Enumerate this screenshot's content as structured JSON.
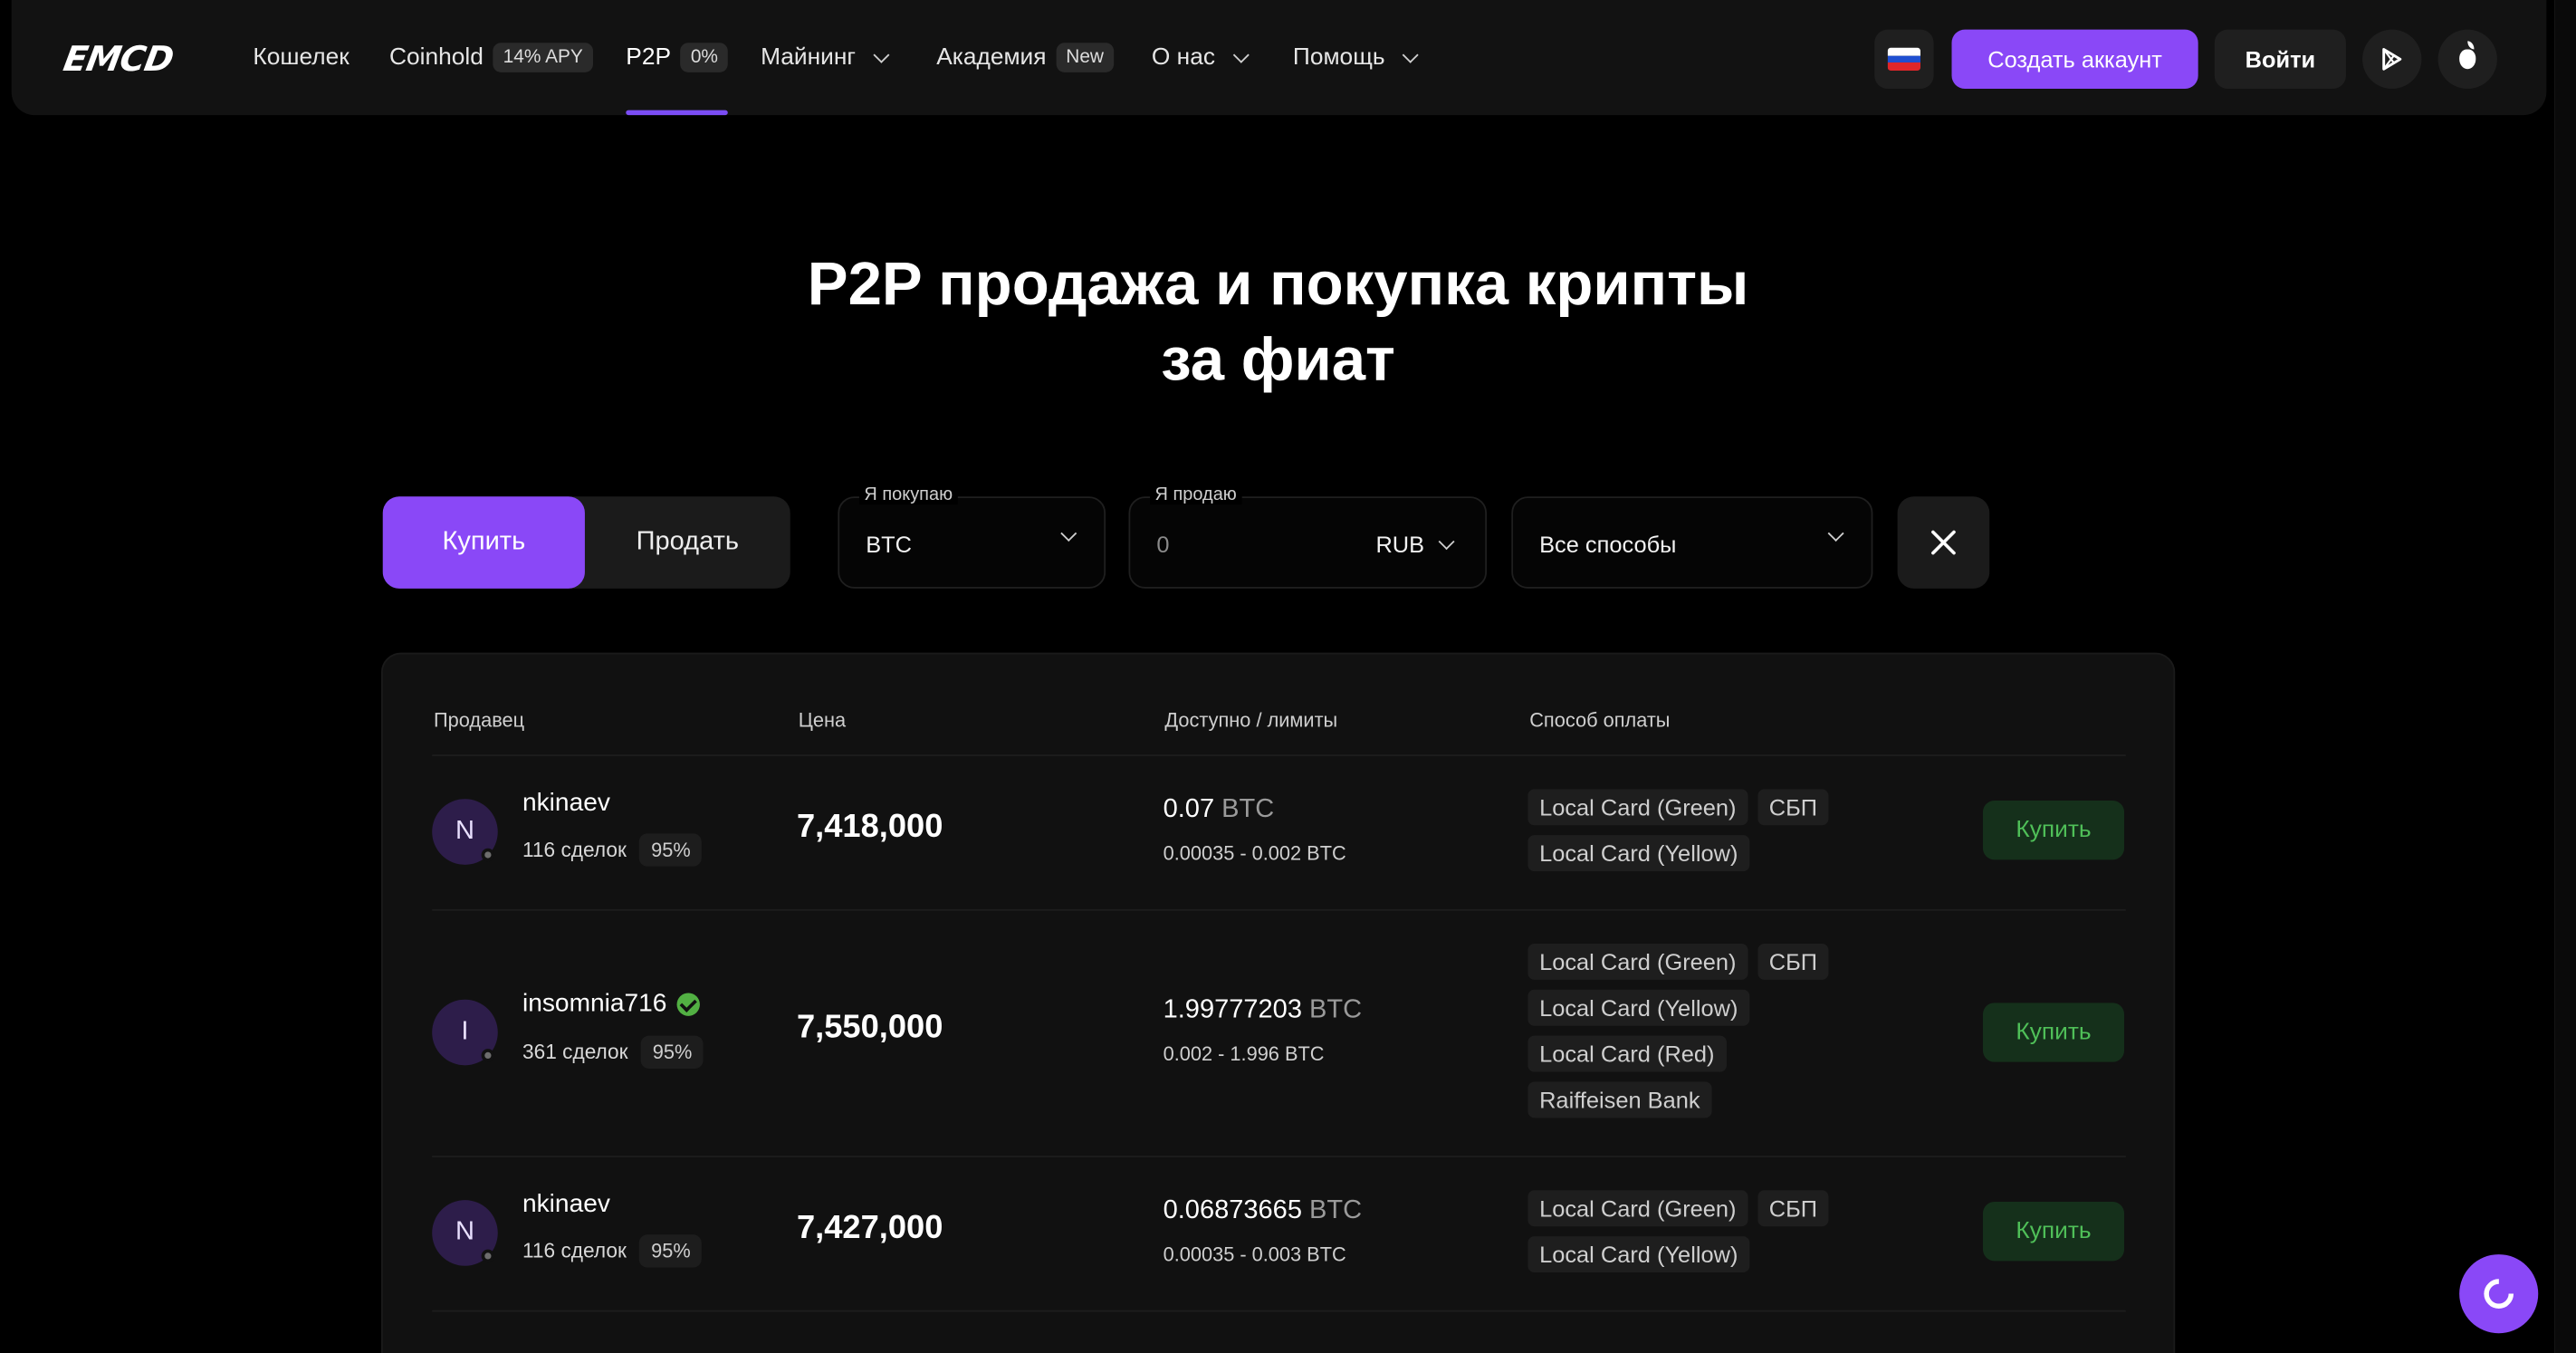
{
  "header": {
    "logo": "EMCD",
    "nav": [
      {
        "label": "Кошелек"
      },
      {
        "label": "Coinhold",
        "badge": "14% APY"
      },
      {
        "label": "P2P",
        "badge": "0%",
        "active": true
      },
      {
        "label": "Майнинг",
        "dropdown": true
      },
      {
        "label": "Академия",
        "badge": "New"
      },
      {
        "label": "О нас",
        "dropdown": true
      },
      {
        "label": "Помощь",
        "dropdown": true
      }
    ],
    "language_icon": "russia-flag-icon",
    "create_account": "Создать аккаунт",
    "login": "Войти",
    "app_icons": [
      "google-play-icon",
      "apple-icon"
    ],
    "accent_color": "#8a48f7"
  },
  "page": {
    "title_line1": "P2P продажа и покупка крипты",
    "title_line2": "за фиат"
  },
  "filters": {
    "mode_buy": "Купить",
    "mode_sell": "Продать",
    "active_mode": "Купить",
    "buy_label": "Я покупаю",
    "buy_coin": "BTC",
    "sell_label": "Я продаю",
    "amount_placeholder": "0",
    "sell_currency": "RUB",
    "method": "Все способы",
    "clear_icon": "close-icon"
  },
  "table": {
    "columns": [
      "Продавец",
      "Цена",
      "Доступно / лимиты",
      "Способ оплаты"
    ],
    "rows": [
      {
        "initial": "N",
        "seller": "nkinaev",
        "verified": false,
        "deals": "116 сделок",
        "rate": "95%",
        "price": "7,418,000",
        "available": "0.07",
        "available_unit": "BTC",
        "limits": "0.00035 - 0.002 BTC",
        "methods": [
          "Local Card (Green)",
          "СБП",
          "Local Card (Yellow)"
        ],
        "action": "Купить"
      },
      {
        "initial": "I",
        "seller": "insomnia716",
        "verified": true,
        "deals": "361 сделок",
        "rate": "95%",
        "price": "7,550,000",
        "available": "1.99777203",
        "available_unit": "BTC",
        "limits": "0.002 - 1.996 BTC",
        "methods": [
          "Local Card (Green)",
          "СБП",
          "Local Card (Yellow)",
          "Local Card (Red)",
          "Raiffeisen Bank"
        ],
        "action": "Купить"
      },
      {
        "initial": "N",
        "seller": "nkinaev",
        "verified": false,
        "deals": "116 сделок",
        "rate": "95%",
        "price": "7,427,000",
        "available": "0.06873665",
        "available_unit": "BTC",
        "limits": "0.00035 - 0.003 BTC",
        "methods": [
          "Local Card (Green)",
          "СБП",
          "Local Card (Yellow)"
        ],
        "action": "Купить"
      }
    ]
  },
  "support_icon": "chat-support-icon"
}
